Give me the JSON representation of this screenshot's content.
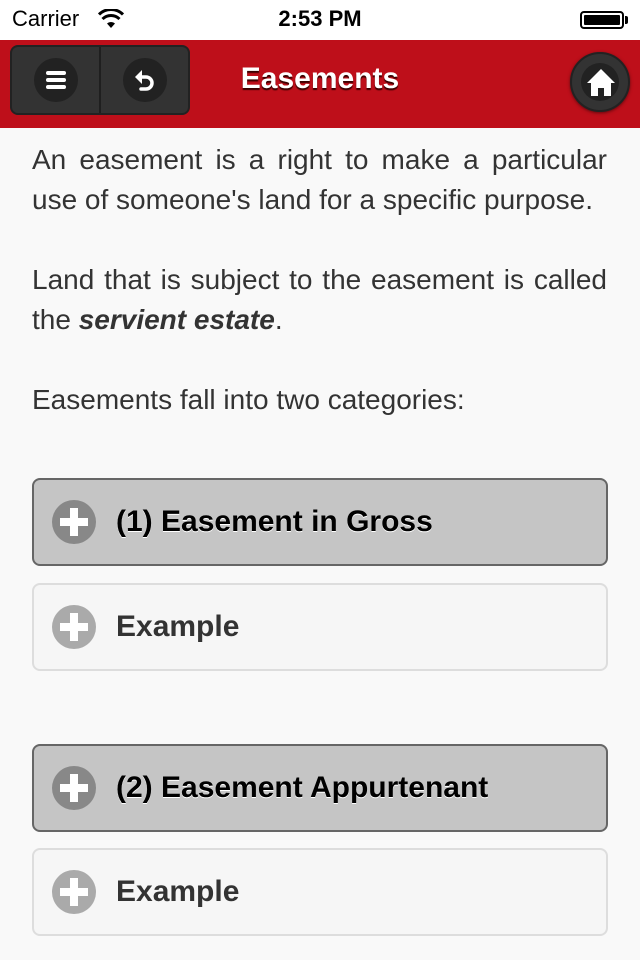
{
  "status_bar": {
    "carrier": "Carrier",
    "time": "2:53 PM",
    "wifi_icon": "wifi-icon",
    "battery_icon": "battery-icon"
  },
  "nav_bar": {
    "title": "Easements",
    "menu_icon": "hamburger-menu-icon",
    "back_icon": "undo-arrow-icon",
    "home_icon": "home-icon",
    "accent_color": "#be0f1a"
  },
  "content": {
    "paragraph_1": "An easement is a right to make a particular use of someone's land for a specific purpose.",
    "paragraph_2_prefix": "Land that is subject to the easement is called the ",
    "paragraph_2_emphasis": "servient estate",
    "paragraph_2_suffix": ".",
    "paragraph_3": "Easements fall into two categories:"
  },
  "collapsibles": [
    {
      "label": "(1) Easement in Gross",
      "type": "heading",
      "icon": "plus-circle-icon"
    },
    {
      "label": "Example",
      "type": "sub",
      "icon": "plus-circle-icon"
    },
    {
      "label": "(2) Easement Appurtenant",
      "type": "heading",
      "icon": "plus-circle-icon"
    },
    {
      "label": "Example",
      "type": "sub",
      "icon": "plus-circle-icon"
    }
  ]
}
